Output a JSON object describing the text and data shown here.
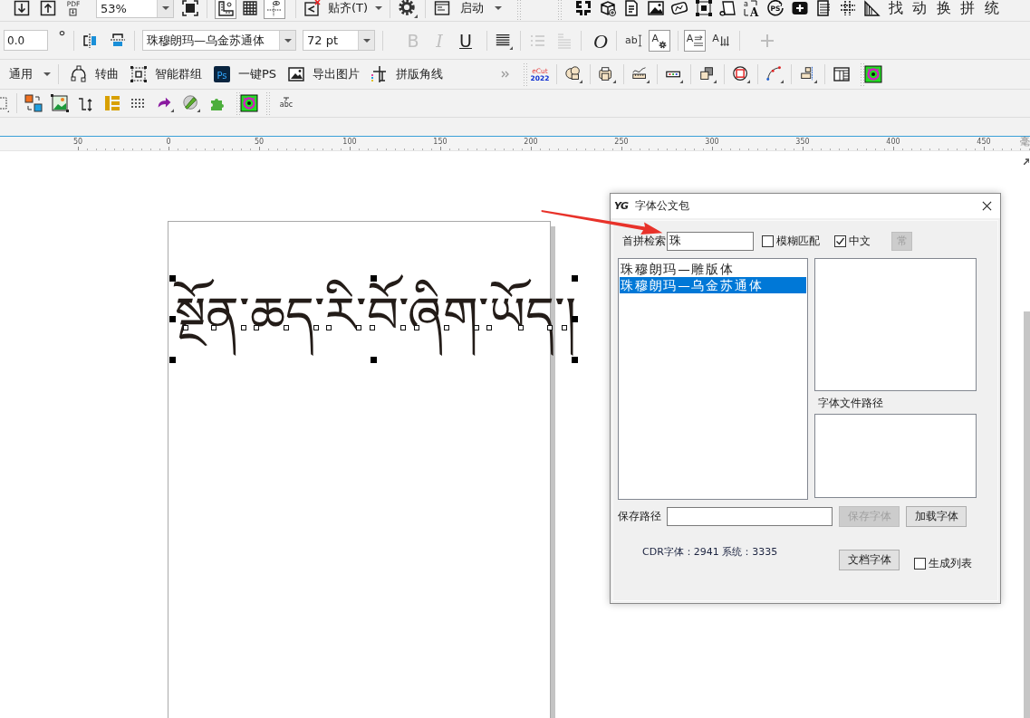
{
  "toolbar_1": {
    "pdf_icon_text": "PDF",
    "zoom": {
      "value": "53%"
    },
    "view_toggles": [
      {
        "on": true
      },
      {
        "on": false
      },
      {
        "on": true
      }
    ],
    "snap_dropdown": {
      "label": "贴齐(T)"
    },
    "launch_dropdown": {
      "label": "启动"
    },
    "text_size_icon_text": [
      "a",
      "A"
    ],
    "ps_icon_text": "PS",
    "char_buttons": [
      "找",
      "动",
      "换",
      "拼",
      "统"
    ]
  },
  "toolbar_2": {
    "angle_field": {
      "value": "0.0"
    },
    "angle_unit": "°",
    "font_dropdown": {
      "value": "珠穆朗玛—乌金苏通体"
    },
    "size_dropdown": {
      "value": "72 pt"
    },
    "style_buttons": [
      {
        "kind": "bold",
        "label": "B",
        "disabled": true
      },
      {
        "kind": "italic",
        "label": "I",
        "disabled": true
      },
      {
        "kind": "underline",
        "label": "U",
        "disabled": false
      }
    ],
    "list_buttons": [
      {
        "disabled": true
      },
      {
        "disabled": true
      }
    ],
    "oblique_button": {
      "label": "O"
    },
    "text_tools": [
      {
        "kind": "cursor",
        "label": "ab",
        "on": false
      },
      {
        "kind": "settings",
        "label": "A",
        "on": true
      }
    ],
    "frame_tools": [
      {
        "kind": "frame",
        "label": "A",
        "on": true
      },
      {
        "kind": "columns",
        "label": "A",
        "on": false
      }
    ],
    "add_button": {
      "disabled": true
    }
  },
  "toolbar_3": {
    "preset_dropdown": {
      "label": "通用"
    },
    "actions": [
      {
        "kind": "curve",
        "label": "转曲"
      },
      {
        "kind": "group",
        "label": "智能群组"
      },
      {
        "kind": "photoshop",
        "label": "一键PS",
        "icon_text": "Ps"
      },
      {
        "kind": "export",
        "label": "导出图片"
      },
      {
        "kind": "cropmarks",
        "label": "拼版角线"
      }
    ],
    "ecut_icon_text": [
      "eCut",
      "2022"
    ]
  },
  "toolbar_4": {
    "abc_icon_text": "abc"
  },
  "ruler": {
    "labels": [
      "50",
      "0",
      "50",
      "100",
      "150",
      "200",
      "250",
      "300",
      "350",
      "400",
      "450"
    ],
    "unit": "毫"
  },
  "canvas": {
    "text_object": {
      "text": "སྔོན་ཆད་རི་བོ་ཞིག་ཡོད་།",
      "selected": true
    }
  },
  "dialog": {
    "logo": "YG",
    "title": "字体公文包",
    "search": {
      "label": "首拼检索",
      "value": "珠"
    },
    "options": [
      {
        "label": "模糊匹配",
        "checked": false
      },
      {
        "label": "中文",
        "checked": true
      }
    ],
    "common_button": {
      "label": "常",
      "disabled": true
    },
    "font_list": [
      {
        "label": "珠穆朗玛—雕版体",
        "selected": false
      },
      {
        "label": "珠穆朗玛—乌金苏通体",
        "selected": true
      }
    ],
    "path_label": "字体文件路径",
    "save_path": {
      "label": "保存路径"
    },
    "save_button": {
      "label": "保存字体",
      "disabled": true
    },
    "load_button": {
      "label": "加载字体",
      "disabled": false
    },
    "stats": "CDR字体：2941 系统：3335",
    "doc_button": {
      "label": "文档字体",
      "disabled": false
    },
    "generate_list": {
      "label": "生成列表",
      "checked": false
    }
  }
}
